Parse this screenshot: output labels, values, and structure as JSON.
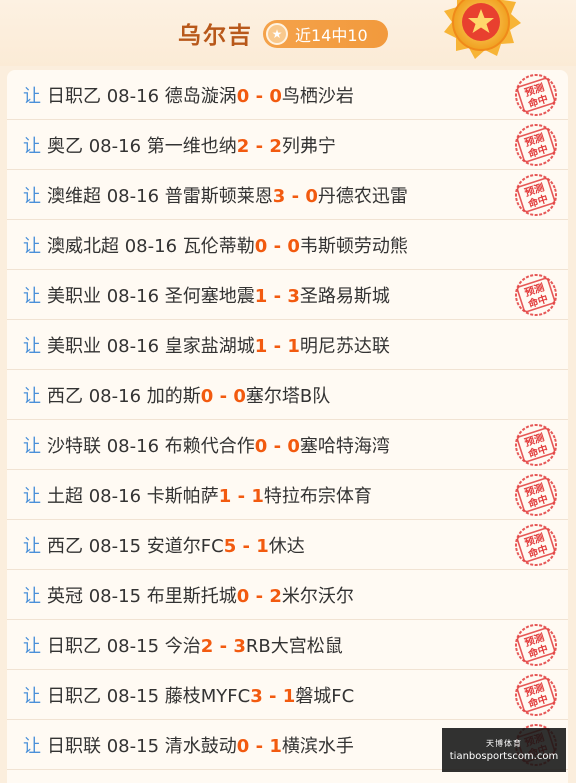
{
  "header": {
    "expert_name": "乌尔吉",
    "badge_text": "近14中10"
  },
  "prefix_label": "让",
  "matches": [
    {
      "league": "日职乙",
      "date": "08-16",
      "home": "德岛漩涡",
      "home_score": "0",
      "sep": " - ",
      "away_score": "0",
      "away": "鸟栖沙岩",
      "hit": true
    },
    {
      "league": "奥乙",
      "date": "08-16",
      "home": "第一维也纳",
      "home_score": "2",
      "sep": " - ",
      "away_score": "2",
      "away": "列弗宁",
      "hit": true
    },
    {
      "league": "澳维超",
      "date": "08-16",
      "home": "普雷斯顿莱恩",
      "home_score": "3",
      "sep": " - ",
      "away_score": "0",
      "away": "丹德农迅雷",
      "hit": true
    },
    {
      "league": "澳威北超",
      "date": "08-16",
      "home": "瓦伦蒂勒",
      "home_score": "0",
      "sep": " - ",
      "away_score": "0",
      "away": "韦斯顿劳动熊",
      "hit": false
    },
    {
      "league": "美职业",
      "date": "08-16",
      "home": "圣何塞地震",
      "home_score": "1",
      "sep": " - ",
      "away_score": "3",
      "away": "圣路易斯城",
      "hit": true
    },
    {
      "league": "美职业",
      "date": "08-16",
      "home": "皇家盐湖城",
      "home_score": "1",
      "sep": " - ",
      "away_score": "1",
      "away": "明尼苏达联",
      "hit": false
    },
    {
      "league": "西乙",
      "date": "08-16",
      "home": "加的斯",
      "home_score": "0",
      "sep": " - ",
      "away_score": "0",
      "away": "塞尔塔B队",
      "hit": false
    },
    {
      "league": "沙特联",
      "date": "08-16",
      "home": "布赖代合作",
      "home_score": "0",
      "sep": " - ",
      "away_score": "0",
      "away": "塞哈特海湾",
      "hit": true
    },
    {
      "league": "土超",
      "date": "08-16",
      "home": "卡斯帕萨",
      "home_score": "1",
      "sep": " - ",
      "away_score": "1",
      "away": "特拉布宗体育",
      "hit": true
    },
    {
      "league": "西乙",
      "date": "08-15",
      "home": "安道尔FC",
      "home_score": "5",
      "sep": " - ",
      "away_score": "1",
      "away": "休达",
      "hit": true
    },
    {
      "league": "英冠",
      "date": "08-15",
      "home": "布里斯托城",
      "home_score": "0",
      "sep": " - ",
      "away_score": "2",
      "away": "米尔沃尔",
      "hit": false
    },
    {
      "league": "日职乙",
      "date": "08-15",
      "home": "今治",
      "home_score": "2",
      "sep": " - ",
      "away_score": "3",
      "away": "RB大宫松鼠",
      "hit": true
    },
    {
      "league": "日职乙",
      "date": "08-15",
      "home": "藤枝MYFC",
      "home_score": "3",
      "sep": " - ",
      "away_score": "1",
      "away": "磐城FC",
      "hit": true
    },
    {
      "league": "日职联",
      "date": "08-15",
      "home": "清水鼓动",
      "home_score": "0",
      "sep": " - ",
      "away_score": "1",
      "away": "横滨水手",
      "hit": true
    }
  ],
  "stamp": {
    "line1": "预测",
    "line2": "命中"
  },
  "watermark": {
    "line1": "天博体育",
    "line2": "tianbosportscom.com"
  },
  "colors": {
    "score": "#f25a0f",
    "prefix": "#4a90d9",
    "title": "#b8581a",
    "stamp": "#e23b3b"
  }
}
